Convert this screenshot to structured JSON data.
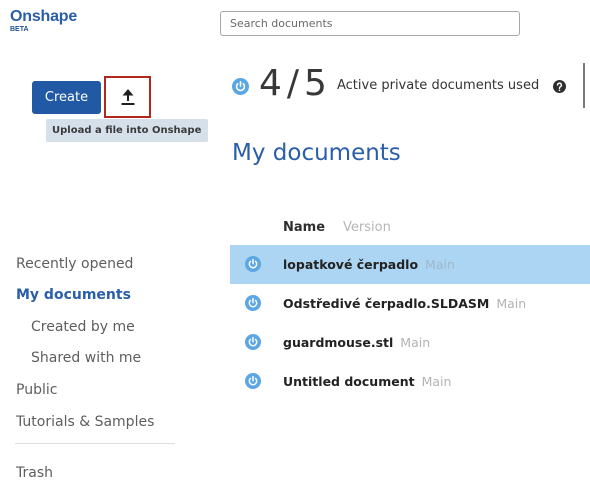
{
  "header": {
    "logo": "Onshape",
    "logo_badge": "BETA",
    "search": {
      "placeholder": "Search documents",
      "value": ""
    }
  },
  "actions": {
    "create_label": "Create",
    "upload_icon": "upload-icon",
    "upload_tooltip": "Upload a file into Onshape"
  },
  "usage": {
    "icon": "document-icon",
    "used": "4",
    "separator": "/",
    "total": "5",
    "label": "Active private documents used",
    "help_icon": "question-circle-icon"
  },
  "main": {
    "title": "My documents",
    "columns": [
      "Name",
      "Version"
    ],
    "rows": [
      {
        "icon": "document-icon",
        "name": "lopatkové čerpadlo",
        "version": "Main",
        "selected": true
      },
      {
        "icon": "document-icon",
        "name": "Odstředivé čerpadlo.SLDASM",
        "version": "Main",
        "selected": false
      },
      {
        "icon": "document-icon",
        "name": "guardmouse.stl",
        "version": "Main",
        "selected": false
      },
      {
        "icon": "document-icon",
        "name": "Untitled document",
        "version": "Main",
        "selected": false
      }
    ]
  },
  "sidebar": {
    "items": [
      {
        "label": "Recently opened",
        "active": false
      },
      {
        "label": "My documents",
        "active": true,
        "children": [
          {
            "label": "Created by me",
            "active": false
          },
          {
            "label": "Shared with me",
            "active": false
          }
        ]
      },
      {
        "label": "Public",
        "active": false
      },
      {
        "label": "Tutorials & Samples",
        "active": false
      }
    ],
    "bottom_items": [
      {
        "label": "Trash",
        "active": false
      }
    ]
  },
  "colors": {
    "brand": "#2a5ea8",
    "brand_dark": "#2159a5",
    "selected_row": "#abd5f2",
    "doc_icon": "#5ba6e3",
    "tooltip_bg": "#d6e0ea",
    "highlight_border": "#b3261e"
  }
}
